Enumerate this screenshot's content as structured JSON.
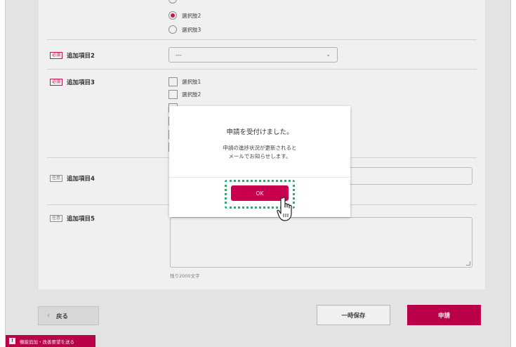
{
  "form": {
    "item1": {
      "options": [
        "選択肢2",
        "選択肢3"
      ],
      "selected": "選択肢2"
    },
    "item2": {
      "required_badge": "必須",
      "label": "追加項目2",
      "select_value": "---"
    },
    "item3": {
      "required_badge": "必須",
      "label": "追加項目3",
      "options": [
        "選択肢1",
        "選択肢2"
      ]
    },
    "item4": {
      "optional_badge": "任意",
      "label": "追加項目4"
    },
    "item5": {
      "optional_badge": "任意",
      "label": "追加項目5",
      "char_counter": "残り2000文字"
    }
  },
  "footer": {
    "back_label": "戻る",
    "back_icon": "‹",
    "save_draft_label": "一時保存",
    "apply_label": "申請"
  },
  "feedback": {
    "icon": "!",
    "label": "機能追加・改善要望を送る"
  },
  "modal": {
    "title": "申請を受付けました。",
    "message_line1": "申請の進捗状況が更新されると",
    "message_line2": "メールでお知らせします。",
    "ok_label": "OK"
  },
  "colors": {
    "accent": "#c7004f",
    "highlight": "#1fb36d"
  },
  "icons": {
    "chevron": "chevron-down-icon",
    "cursor": "hand-pointer-icon"
  }
}
